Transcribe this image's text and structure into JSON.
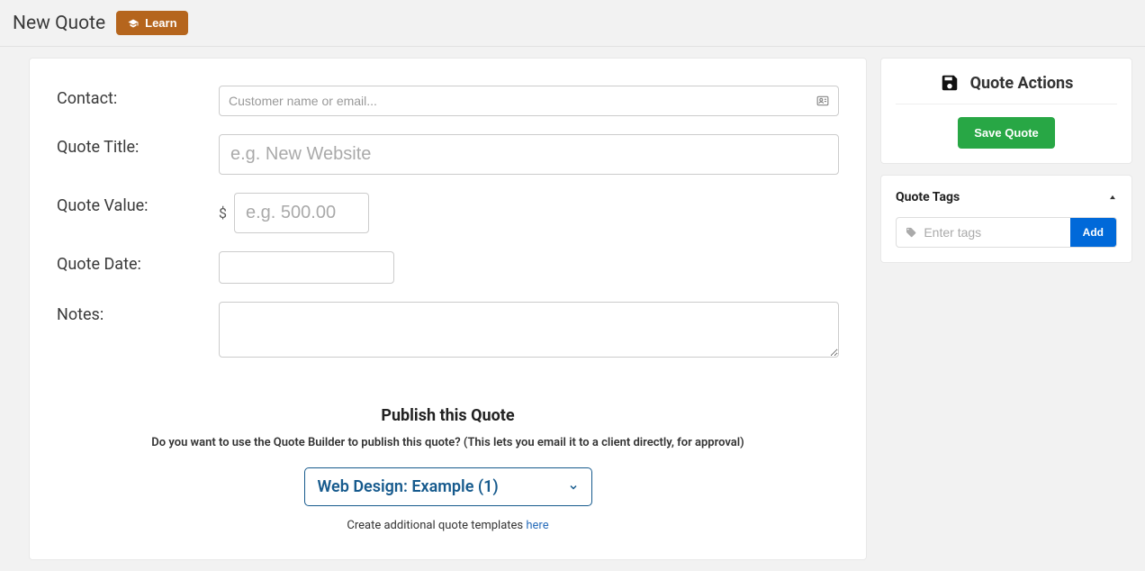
{
  "header": {
    "title": "New Quote",
    "learn_label": "Learn"
  },
  "form": {
    "contact": {
      "label": "Contact:",
      "placeholder": "Customer name or email..."
    },
    "title": {
      "label": "Quote Title:",
      "placeholder": "e.g. New Website"
    },
    "value": {
      "label": "Quote Value:",
      "currency": "$",
      "placeholder": "e.g. 500.00"
    },
    "date": {
      "label": "Quote Date:"
    },
    "notes": {
      "label": "Notes:"
    }
  },
  "publish": {
    "heading": "Publish this Quote",
    "description": "Do you want to use the Quote Builder to publish this quote? (This lets you email it to a client directly, for approval)",
    "selected_template": "Web Design: Example (1)",
    "create_text": "Create additional quote templates ",
    "create_link": "here"
  },
  "sidebar": {
    "actions_title": "Quote Actions",
    "save_label": "Save Quote",
    "tags_title": "Quote Tags",
    "tags_placeholder": "Enter tags",
    "tags_add_label": "Add"
  }
}
